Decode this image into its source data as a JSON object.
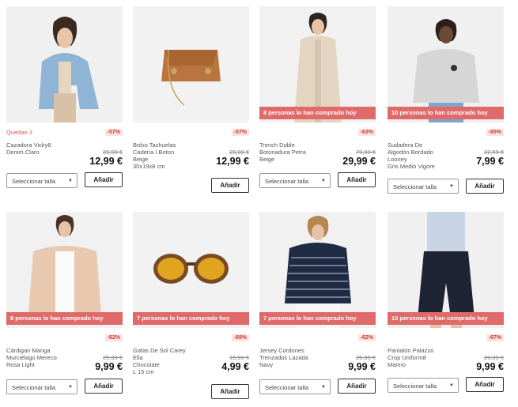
{
  "actions": {
    "select_size": "Seleccionar talla",
    "add": "Añadir"
  },
  "row1": [
    {
      "stock": "Quedan 3",
      "discount": "-57%",
      "name": "Cazadora Vicky8\nDenim Claro",
      "old_price": "29,99 €",
      "price": "12,99 €",
      "banner": ""
    },
    {
      "stock": "",
      "discount": "-57%",
      "name": "Bolso Tachuelas\nCadena I Boton\nBeige\n30x19x8 cm",
      "old_price": "29,99 €",
      "price": "12,99 €",
      "banner": ""
    },
    {
      "stock": "",
      "discount": "-63%",
      "name": "Trench Doble\nBotonadura Petra\nBeige",
      "old_price": "79,99 €",
      "price": "29,99 €",
      "banner": "8 personas lo han comprado hoy"
    },
    {
      "stock": "",
      "discount": "-65%",
      "name": "Sudadera De\nAlgodón Bordado\nLooney\nGris Medio Vigore",
      "old_price": "22,99 €",
      "price": "7,99 €",
      "banner": "10 personas lo han comprado hoy"
    }
  ],
  "row2": [
    {
      "discount": "-62%",
      "name": "Cárdigan Manga\nMurciélago Mereco\nRosa Light",
      "old_price": "25,99 €",
      "price": "9,99 €",
      "banner": "8 personas lo han comprado hoy"
    },
    {
      "discount": "-69%",
      "name": "Gafas De Sol Carey\nElla\nChocolate\nL 15 cm",
      "old_price": "15,99 €",
      "price": "4,99 €",
      "banner": "7 personas lo han comprado hoy"
    },
    {
      "discount": "-62%",
      "name": "Jersey Cordones\nTrenzados Lazada\nNavy",
      "old_price": "25,99 €",
      "price": "9,99 €",
      "banner": "7 personas lo han comprado hoy"
    },
    {
      "discount": "-67%",
      "name": "Pantalón Palazzo\nCrop Uniform8\nMarino",
      "old_price": "29,99 €",
      "price": "9,99 €",
      "banner": "10 personas lo han comprado hoy"
    }
  ]
}
